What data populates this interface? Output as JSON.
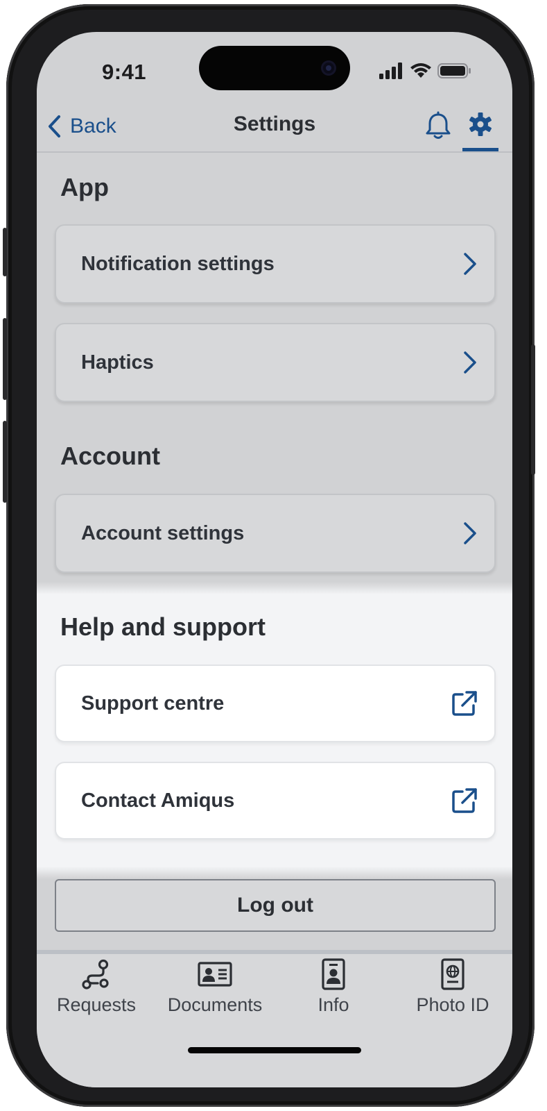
{
  "status_bar": {
    "time": "9:41"
  },
  "header": {
    "back_label": "Back",
    "title": "Settings"
  },
  "sections": {
    "app": {
      "title": "App",
      "items": [
        {
          "label": "Notification settings"
        },
        {
          "label": "Haptics"
        }
      ]
    },
    "account": {
      "title": "Account",
      "items": [
        {
          "label": "Account settings"
        }
      ]
    },
    "help": {
      "title": "Help and support",
      "items": [
        {
          "label": "Support centre"
        },
        {
          "label": "Contact Amiqus"
        }
      ]
    }
  },
  "logout_label": "Log out",
  "tabbar": {
    "items": [
      {
        "label": "Requests",
        "icon": "route-icon"
      },
      {
        "label": "Documents",
        "icon": "id-card-icon"
      },
      {
        "label": "Info",
        "icon": "contact-badge-icon"
      },
      {
        "label": "Photo ID",
        "icon": "passport-icon"
      }
    ]
  },
  "colors": {
    "accent": "#1a4f8b",
    "overlay_background": "#d1d2d4",
    "highlight_background": "#f3f4f6",
    "text_primary": "#2b2e33"
  }
}
